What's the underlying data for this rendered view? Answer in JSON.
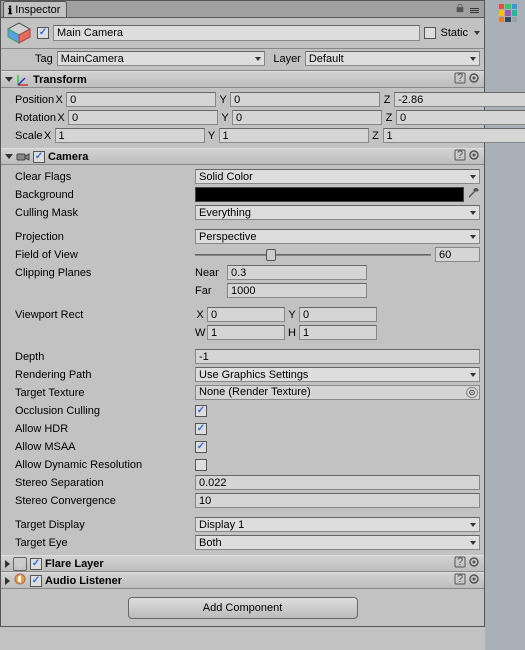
{
  "tab_title": "Inspector",
  "object_name": "Main Camera",
  "static_label": "Static",
  "tag_label": "Tag",
  "tag_value": "MainCamera",
  "layer_label": "Layer",
  "layer_value": "Default",
  "transform": {
    "title": "Transform",
    "position": {
      "label": "Position",
      "x": "0",
      "y": "0",
      "z": "-2.86"
    },
    "rotation": {
      "label": "Rotation",
      "x": "0",
      "y": "0",
      "z": "0"
    },
    "scale": {
      "label": "Scale",
      "x": "1",
      "y": "1",
      "z": "1"
    }
  },
  "camera": {
    "title": "Camera",
    "clear_flags": {
      "label": "Clear Flags",
      "value": "Solid Color"
    },
    "background": {
      "label": "Background"
    },
    "culling_mask": {
      "label": "Culling Mask",
      "value": "Everything"
    },
    "projection": {
      "label": "Projection",
      "value": "Perspective"
    },
    "fov": {
      "label": "Field of View",
      "value": "60"
    },
    "clipping": {
      "label": "Clipping Planes",
      "near_label": "Near",
      "near": "0.3",
      "far_label": "Far",
      "far": "1000"
    },
    "viewport": {
      "label": "Viewport Rect",
      "x": "0",
      "y": "0",
      "w": "1",
      "h": "1"
    },
    "depth": {
      "label": "Depth",
      "value": "-1"
    },
    "rendering_path": {
      "label": "Rendering Path",
      "value": "Use Graphics Settings"
    },
    "target_texture": {
      "label": "Target Texture",
      "value": "None (Render Texture)"
    },
    "occlusion": {
      "label": "Occlusion Culling",
      "checked": true
    },
    "allow_hdr": {
      "label": "Allow HDR",
      "checked": true
    },
    "allow_msaa": {
      "label": "Allow MSAA",
      "checked": true
    },
    "dynamic_res": {
      "label": "Allow Dynamic Resolution",
      "checked": false
    },
    "stereo_sep": {
      "label": "Stereo Separation",
      "value": "0.022"
    },
    "stereo_conv": {
      "label": "Stereo Convergence",
      "value": "10"
    },
    "target_display": {
      "label": "Target Display",
      "value": "Display 1"
    },
    "target_eye": {
      "label": "Target Eye",
      "value": "Both"
    }
  },
  "flare_layer": {
    "title": "Flare Layer"
  },
  "audio_listener": {
    "title": "Audio Listener"
  },
  "add_component": "Add Component",
  "axis": {
    "X": "X",
    "Y": "Y",
    "Z": "Z",
    "W": "W",
    "H": "H"
  }
}
